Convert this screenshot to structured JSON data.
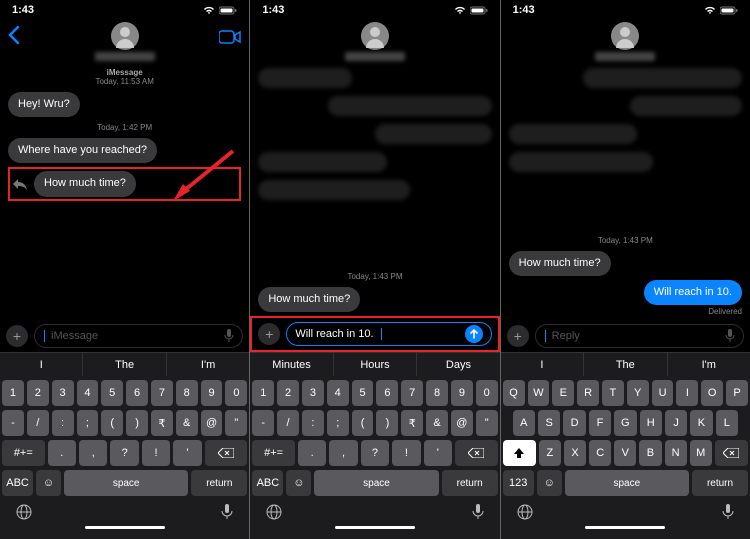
{
  "statusbar": {
    "time": "1:43"
  },
  "left": {
    "stamp1": {
      "label": "iMessage",
      "time": "Today, 11:53 AM"
    },
    "msg1": "Hey! Wru?",
    "stamp2": "Today, 1:42 PM",
    "msg2": "Where have you reached?",
    "msg3": "How much time?",
    "input_placeholder": "iMessage",
    "predict": [
      "I",
      "The",
      "I'm"
    ]
  },
  "middle": {
    "stamp": "Today, 1:43 PM",
    "msg": "How much time?",
    "typed": "Will reach in 10.",
    "predict": [
      "Minutes",
      "Hours",
      "Days"
    ]
  },
  "right": {
    "stamp": "Today, 1:43 PM",
    "msg_in": "How much time?",
    "msg_out": "Will reach in 10.",
    "delivered": "Delivered",
    "input_placeholder": "Reply",
    "predict": [
      "I",
      "The",
      "I'm"
    ]
  },
  "keyboard": {
    "num_row": [
      "1",
      "2",
      "3",
      "4",
      "5",
      "6",
      "7",
      "8",
      "9",
      "0"
    ],
    "sym_row1": [
      "-",
      "/",
      ":",
      ";",
      "(",
      ")",
      "₹",
      "&",
      "@",
      "\""
    ],
    "sym_row2": [
      ".",
      ",",
      "?",
      "!",
      "'"
    ],
    "qwerty_row1": [
      "Q",
      "W",
      "E",
      "R",
      "T",
      "Y",
      "U",
      "I",
      "O",
      "P"
    ],
    "qwerty_row2": [
      "A",
      "S",
      "D",
      "F",
      "G",
      "H",
      "J",
      "K",
      "L"
    ],
    "qwerty_row3": [
      "Z",
      "X",
      "C",
      "V",
      "B",
      "N",
      "M"
    ],
    "space": "space",
    "return": "return",
    "mode_abc": "ABC",
    "mode_123": "123",
    "mode_sym": "#+="
  }
}
